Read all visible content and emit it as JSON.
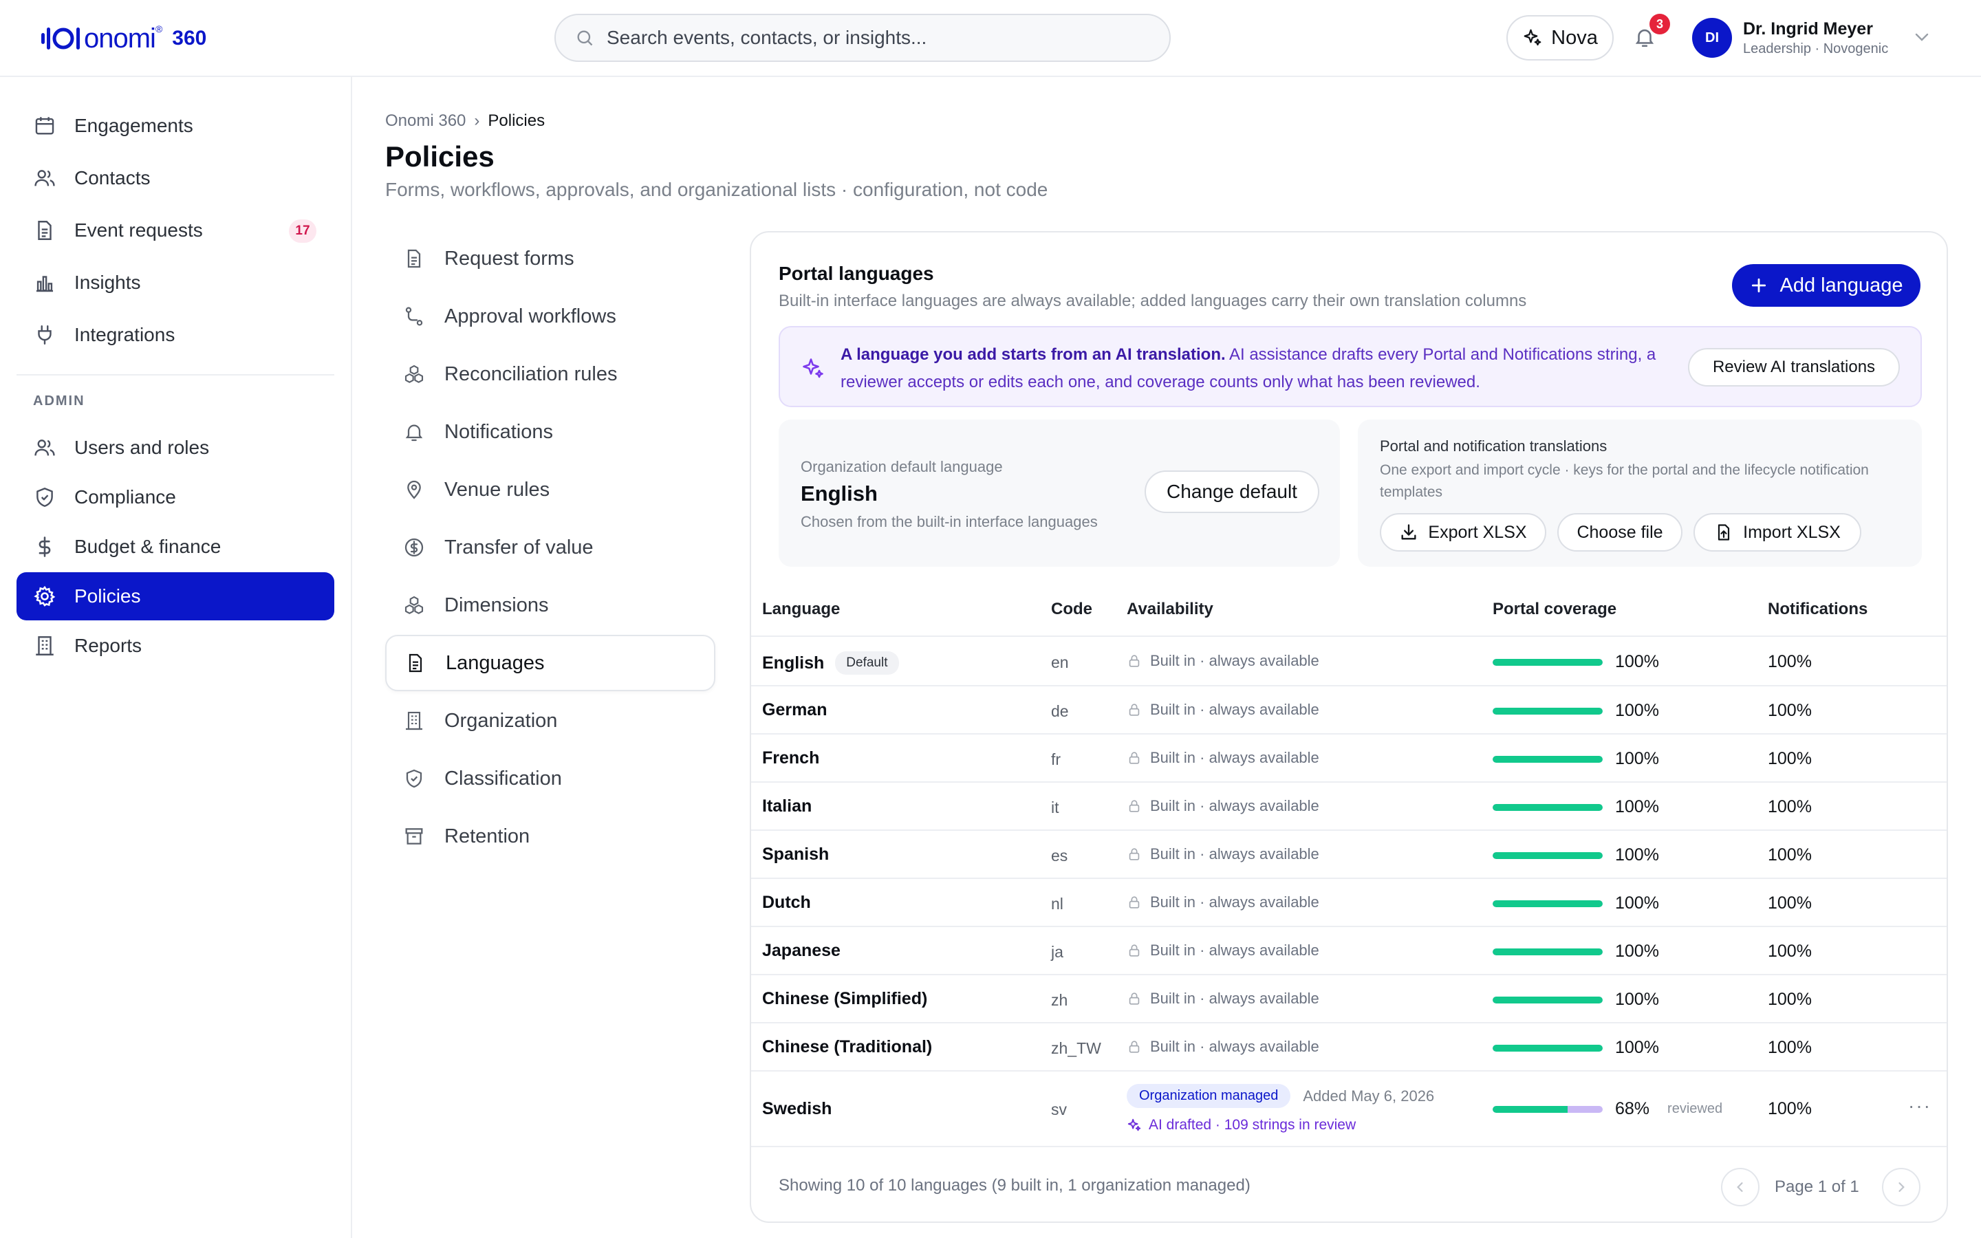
{
  "header": {
    "logo_text": "onomi",
    "logo_reg": "®",
    "logo_suffix": "360",
    "search_placeholder": "Search events, contacts, or insights...",
    "nova_label": "Nova",
    "notifications_count": "3",
    "user": {
      "initials": "DI",
      "name": "Dr. Ingrid Meyer",
      "org": "Leadership · Novogenic"
    }
  },
  "sidebar": {
    "items": [
      {
        "label": "Engagements",
        "icon": "calendar-icon"
      },
      {
        "label": "Contacts",
        "icon": "users-icon"
      },
      {
        "label": "Event requests",
        "icon": "document-icon",
        "badge": "17"
      },
      {
        "label": "Insights",
        "icon": "bar-chart-icon"
      },
      {
        "label": "Integrations",
        "icon": "plug-icon"
      }
    ],
    "admin_label": "ADMIN",
    "admin_items": [
      {
        "label": "Users and roles",
        "icon": "users-icon"
      },
      {
        "label": "Compliance",
        "icon": "shield-icon"
      },
      {
        "label": "Budget & finance",
        "icon": "dollar-icon"
      },
      {
        "label": "Policies",
        "icon": "gear-icon",
        "active": true
      },
      {
        "label": "Reports",
        "icon": "building-icon"
      }
    ]
  },
  "page": {
    "breadcrumb_root": "Onomi 360",
    "breadcrumb_sep": "›",
    "breadcrumb_current": "Policies",
    "title": "Policies",
    "subtitle": "Forms, workflows, approvals, and organizational lists · configuration, not code"
  },
  "subnav": [
    {
      "label": "Request forms",
      "icon": "document-icon"
    },
    {
      "label": "Approval workflows",
      "icon": "workflow-icon"
    },
    {
      "label": "Reconciliation rules",
      "icon": "cubes-icon"
    },
    {
      "label": "Notifications",
      "icon": "bell-icon"
    },
    {
      "label": "Venue rules",
      "icon": "pin-icon"
    },
    {
      "label": "Transfer of value",
      "icon": "dollar-circle-icon"
    },
    {
      "label": "Dimensions",
      "icon": "cubes-icon"
    },
    {
      "label": "Languages",
      "icon": "document-icon",
      "active": true
    },
    {
      "label": "Organization",
      "icon": "building-icon"
    },
    {
      "label": "Classification",
      "icon": "shield-icon"
    },
    {
      "label": "Retention",
      "icon": "archive-icon"
    }
  ],
  "panel": {
    "title": "Portal languages",
    "description": "Built-in interface languages are always available; added languages carry their own translation columns",
    "add_button": "Add language",
    "ai_banner": {
      "bold": "A language you add starts from an AI translation.",
      "text": " AI assistance drafts every Portal and Notifications string, a reviewer accepts or edits each one, and coverage counts only what has been reviewed.",
      "button": "Review AI translations"
    },
    "default_card": {
      "label": "Organization default language",
      "value": "English",
      "hint": "Chosen from the built-in interface languages",
      "button": "Change default"
    },
    "translations_card": {
      "title": "Portal and notification translations",
      "description": "One export and import cycle · keys for the portal and the lifecycle notification templates",
      "export": "Export XLSX",
      "choose": "Choose file",
      "import": "Import XLSX"
    }
  },
  "table": {
    "headers": {
      "language": "Language",
      "code": "Code",
      "availability": "Availability",
      "portal": "Portal coverage",
      "notifications": "Notifications"
    },
    "default_pill": "Default",
    "builtin_text": "Built in · always available",
    "rows": [
      {
        "language": "English",
        "code": "en",
        "portal": "100%",
        "notifications": "100%",
        "coverage": 1.0,
        "default": true
      },
      {
        "language": "German",
        "code": "de",
        "portal": "100%",
        "notifications": "100%",
        "coverage": 1.0
      },
      {
        "language": "French",
        "code": "fr",
        "portal": "100%",
        "notifications": "100%",
        "coverage": 1.0
      },
      {
        "language": "Italian",
        "code": "it",
        "portal": "100%",
        "notifications": "100%",
        "coverage": 1.0
      },
      {
        "language": "Spanish",
        "code": "es",
        "portal": "100%",
        "notifications": "100%",
        "coverage": 1.0
      },
      {
        "language": "Dutch",
        "code": "nl",
        "portal": "100%",
        "notifications": "100%",
        "coverage": 1.0
      },
      {
        "language": "Japanese",
        "code": "ja",
        "portal": "100%",
        "notifications": "100%",
        "coverage": 1.0
      },
      {
        "language": "Chinese (Simplified)",
        "code": "zh",
        "portal": "100%",
        "notifications": "100%",
        "coverage": 1.0
      },
      {
        "language": "Chinese (Traditional)",
        "code": "zh_TW",
        "portal": "100%",
        "notifications": "100%",
        "coverage": 1.0
      }
    ],
    "managed_row": {
      "language": "Swedish",
      "code": "sv",
      "pill": "Organization managed",
      "added": "Added May 6, 2026",
      "ai_note": "AI drafted · 109 strings in review",
      "portal": "68%",
      "coverage": 0.68,
      "reviewed_label": "reviewed",
      "notifications": "100%",
      "more": "···"
    },
    "footer": "Showing 10 of 10 languages (9 built in, 1 organization managed)",
    "page_label": "Page 1 of 1"
  },
  "colors": {
    "brand": "#0b17c9",
    "coverage": "#11c98c",
    "in_review": "#c9b8f5",
    "ai": "#6a2bd9",
    "badge": "#e5233b"
  }
}
